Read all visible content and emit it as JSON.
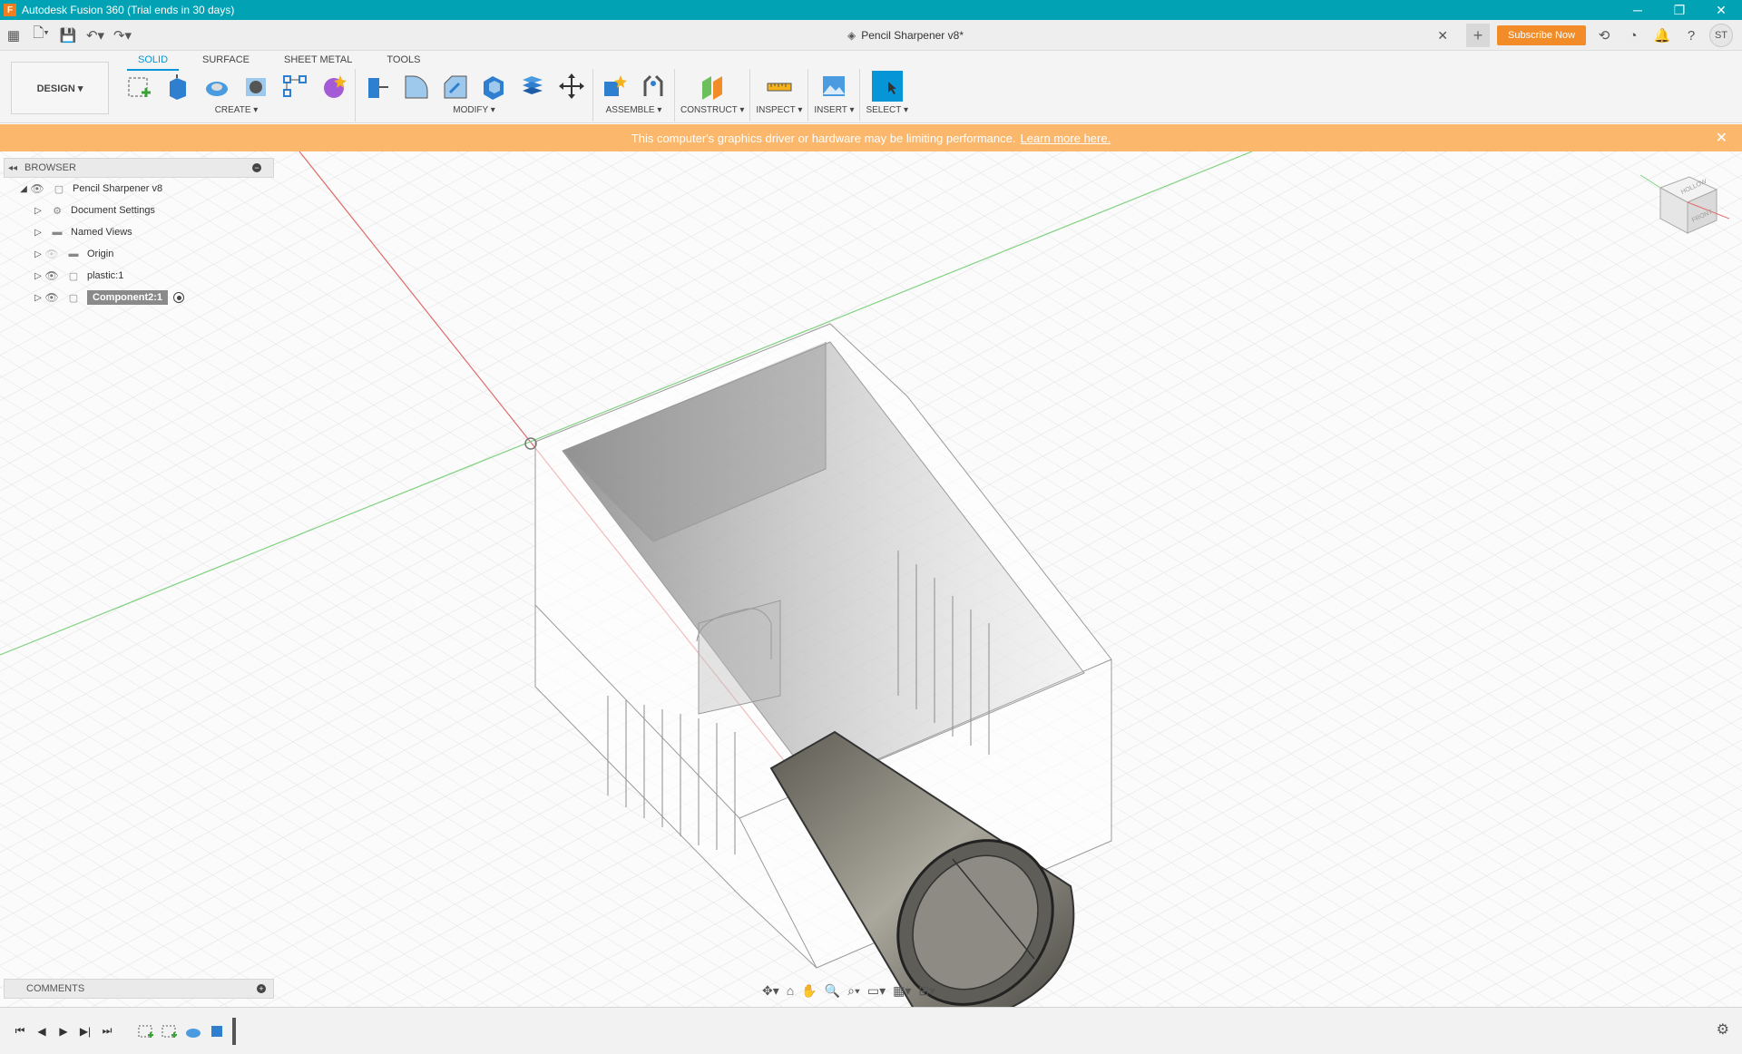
{
  "window": {
    "title": "Autodesk Fusion 360 (Trial ends in 30 days)",
    "app_icon": "F"
  },
  "document": {
    "tab_title": "Pencil Sharpener v8*"
  },
  "header": {
    "subscribe_label": "Subscribe Now",
    "user_initials": "ST"
  },
  "ribbon": {
    "workspace": "DESIGN ▾",
    "tabs": [
      "SOLID",
      "SURFACE",
      "SHEET METAL",
      "TOOLS"
    ],
    "groups": [
      "CREATE ▾",
      "MODIFY ▾",
      "ASSEMBLE ▾",
      "CONSTRUCT ▾",
      "INSPECT ▾",
      "INSERT ▾",
      "SELECT ▾"
    ]
  },
  "warning": {
    "text": "This computer's graphics driver or hardware may be limiting performance.",
    "link": "Learn more here."
  },
  "browser": {
    "title": "BROWSER",
    "items": [
      "Pencil Sharpener v8",
      "Document Settings",
      "Named Views",
      "Origin",
      "plastic:1",
      "Component2:1"
    ]
  },
  "comments": {
    "title": "COMMENTS"
  },
  "viewcube": {
    "top_label": "HOLLOW",
    "front_label": "FRONT"
  },
  "colors": {
    "titlebar": "#00a2b4",
    "accent": "#0696d7",
    "warning": "#fbb76b",
    "subscribe": "#f28c28"
  }
}
